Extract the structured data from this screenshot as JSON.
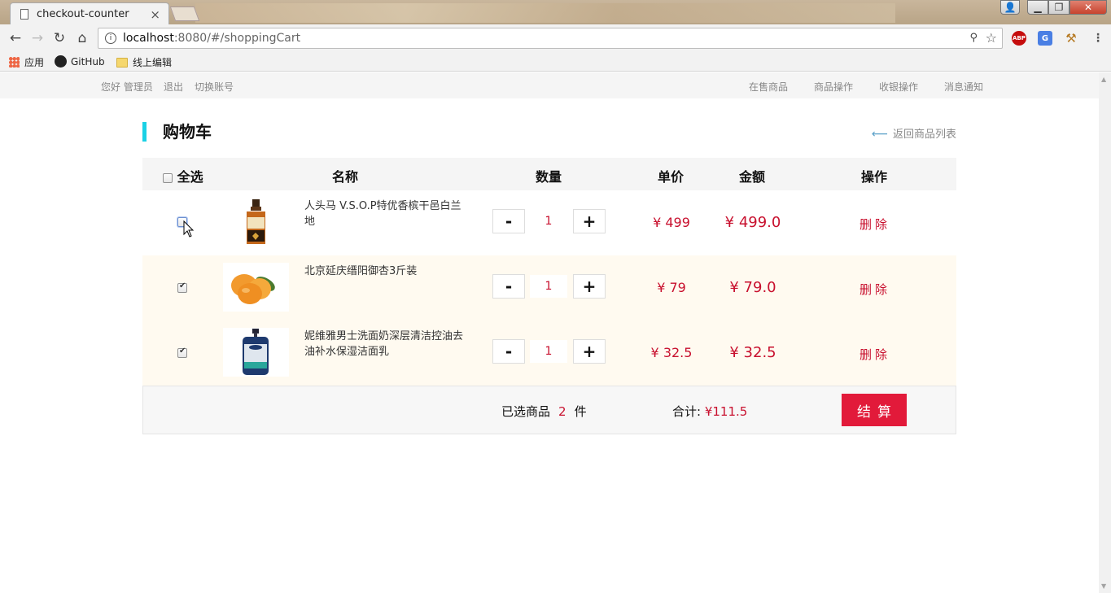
{
  "browser": {
    "tab_title": "checkout-counter",
    "tab_close": "×",
    "url_host": "localhost",
    "url_path": ":8080/#/shoppingCart",
    "bookmarks": [
      {
        "label": "应用",
        "icon": "apps-grid-icon"
      },
      {
        "label": "GitHub",
        "icon": "github-icon"
      },
      {
        "label": "线上编辑",
        "icon": "folder-icon"
      }
    ],
    "extensions": {
      "abp": "ABP",
      "translate": "G"
    }
  },
  "site_nav": {
    "greeting": "您好 管理员",
    "logout": "退出",
    "switch_account": "切换账号",
    "links": [
      "在售商品",
      "商品操作",
      "收银操作",
      "消息通知"
    ]
  },
  "cart": {
    "title": "购物车",
    "back_link": "返回商品列表",
    "headers": {
      "select_all": "全选",
      "name": "名称",
      "quantity": "数量",
      "unit_price": "单价",
      "amount": "金额",
      "action": "操作"
    },
    "select_all_checked": false,
    "items": [
      {
        "checked": false,
        "name": "人头马 V.S.O.P特优香槟干邑白兰地",
        "image": "cognac-bottle",
        "quantity": "1",
        "price": "¥ 499",
        "amount": "¥ 499.0",
        "minus": "-",
        "plus": "+",
        "delete": "删除"
      },
      {
        "checked": true,
        "name": "北京延庆缙阳御杏3斤装",
        "image": "apricots",
        "quantity": "1",
        "price": "¥ 79",
        "amount": "¥ 79.0",
        "minus": "-",
        "plus": "+",
        "delete": "删除"
      },
      {
        "checked": true,
        "name": "妮维雅男士洗面奶深层清洁控油去油补水保湿洁面乳",
        "image": "nivea-cleanser",
        "quantity": "1",
        "price": "¥ 32.5",
        "amount": "¥ 32.5",
        "minus": "-",
        "plus": "+",
        "delete": "删除"
      }
    ],
    "footer": {
      "selected_prefix": "已选商品",
      "selected_count": "2",
      "selected_suffix": "件",
      "total_label": "合计:",
      "total_value": "¥111.5",
      "checkout": "结算"
    }
  },
  "colors": {
    "accent_cyan": "#1ad1e5",
    "price_red": "#c8102e",
    "checkout_red": "#e21a3a",
    "selected_row_bg": "#fffaf0"
  }
}
